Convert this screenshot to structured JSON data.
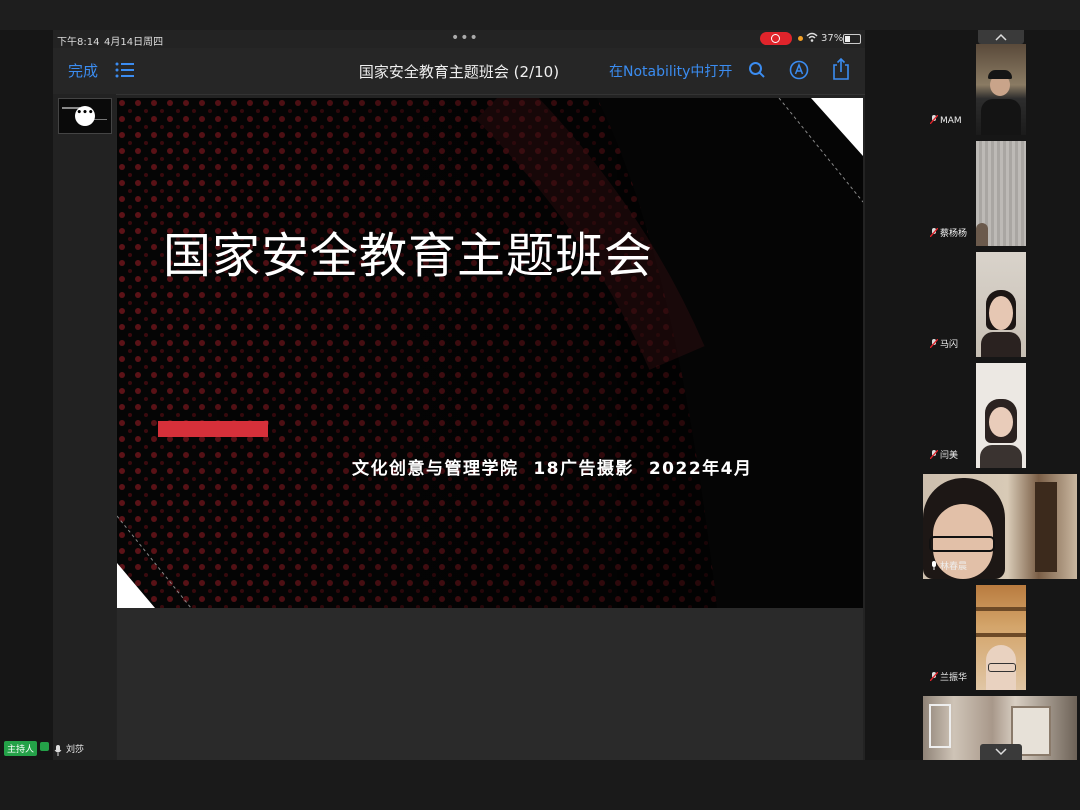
{
  "status": {
    "time": "下午8:14",
    "date": "4月14日周四",
    "battery": "37%"
  },
  "nav": {
    "done": "完成",
    "title": "国家安全教育主题班会 (2/10)",
    "open_in": "在Notability中打开"
  },
  "slide": {
    "title": "国家安全教育主题班会",
    "subtitle": "文化创意与管理学院  18广告摄影  2022年4月"
  },
  "participants": [
    {
      "name": "MAM",
      "muted": true
    },
    {
      "name": "蔡杨杨",
      "muted": true
    },
    {
      "name": "马闪",
      "muted": true
    },
    {
      "name": "闫美",
      "muted": true
    },
    {
      "name": "林春晨",
      "muted": false
    },
    {
      "name": "兰振华",
      "muted": true
    }
  ],
  "bottom": {
    "host_badge": "主持人",
    "user_name": "刘莎"
  },
  "colors": {
    "accent": "#3b8cf0",
    "record": "#e0242b",
    "slide_bar": "#d6303a",
    "host_badge": "#24a148"
  }
}
